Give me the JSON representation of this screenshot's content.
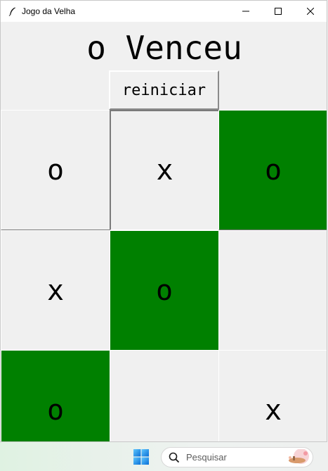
{
  "window": {
    "title": "Jogo da Velha",
    "controls": [
      "minimize-icon",
      "maximize-icon",
      "close-icon"
    ]
  },
  "game": {
    "status": "o Venceu",
    "restart_label": "reiniciar",
    "winning_color": "#008000",
    "board": [
      [
        "o",
        "x",
        "o"
      ],
      [
        "x",
        "o",
        ""
      ],
      [
        "o",
        "",
        "x"
      ]
    ],
    "winning_cells": [
      [
        0,
        2
      ],
      [
        1,
        1
      ],
      [
        2,
        0
      ]
    ]
  },
  "taskbar": {
    "start_icon": "windows-start-icon",
    "search_placeholder": "Pesquisar"
  }
}
